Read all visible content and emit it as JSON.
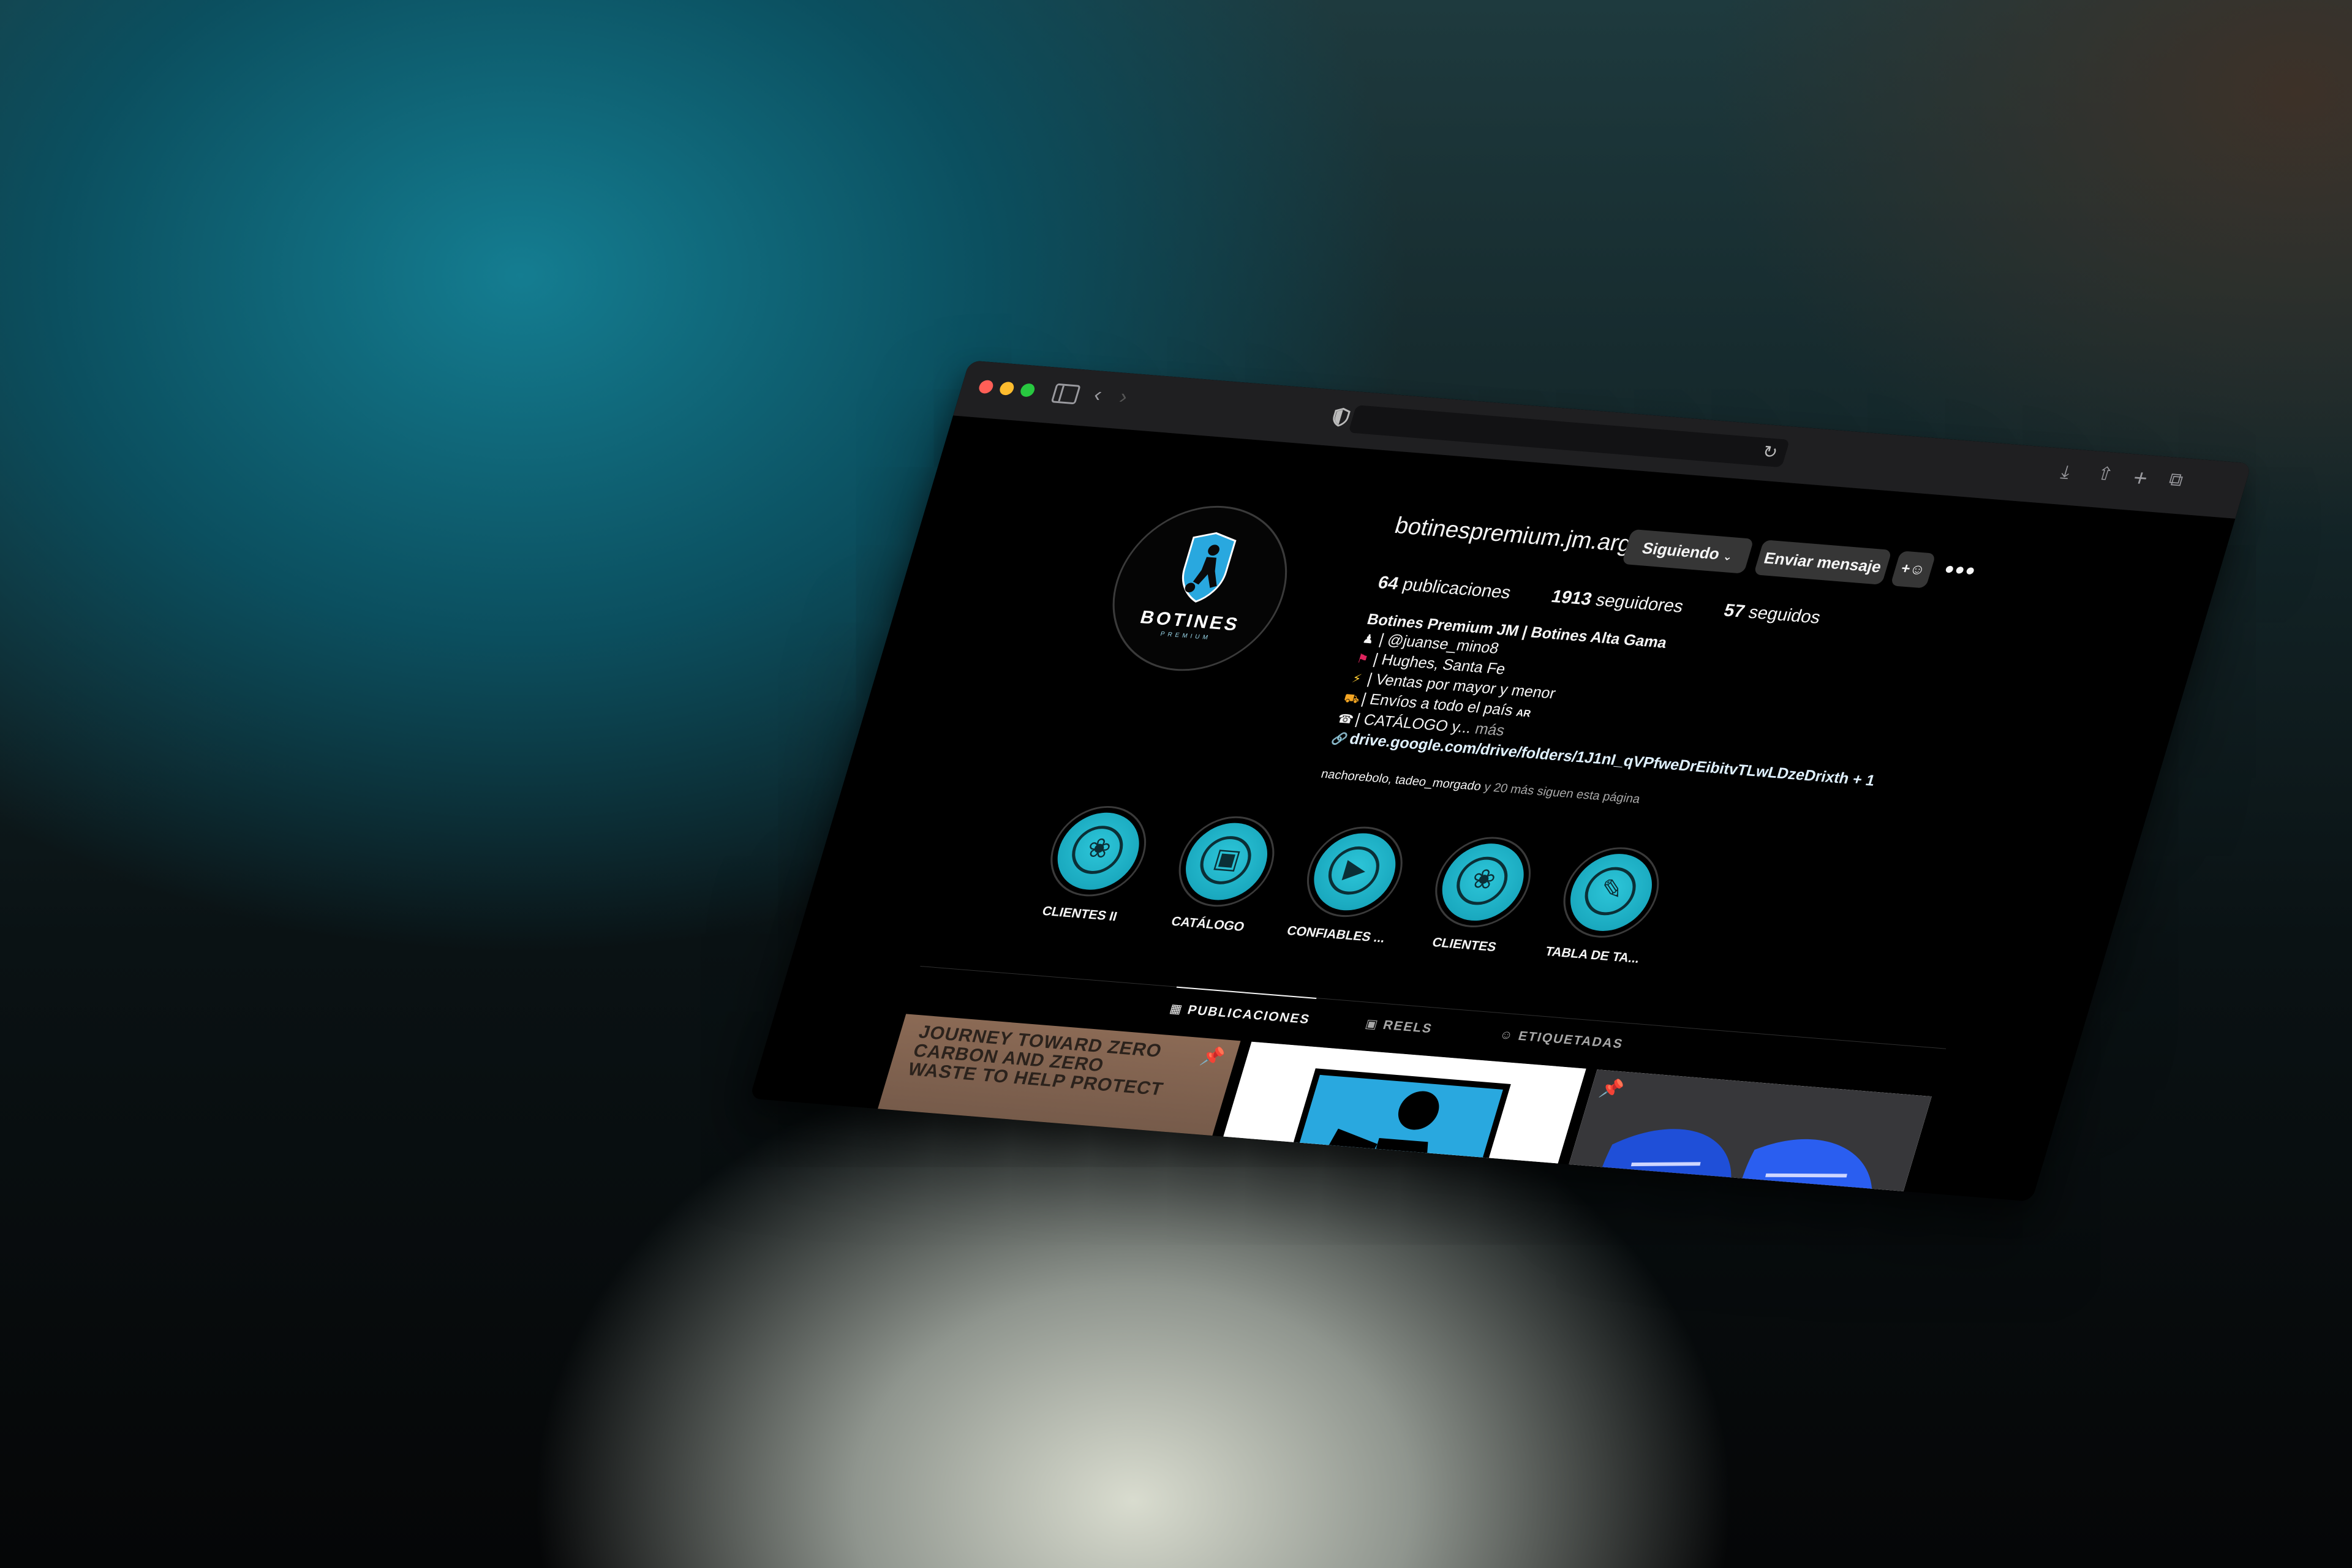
{
  "browser": {
    "tab_icon": "shield-icon",
    "reload_icon": "reload-icon",
    "toolbar_icons": [
      "download-icon",
      "share-icon",
      "new-tab-icon",
      "tabs-overview-icon"
    ]
  },
  "profile": {
    "username": "botinespremium.jm.arg",
    "avatar_logo_text": "BOTINES",
    "avatar_logo_sub": "PREMIUM",
    "following_button": "Siguiendo",
    "message_button": "Enviar mensaje",
    "suggest_button": "+",
    "more_button": "•••",
    "stats": {
      "posts_count": "64",
      "posts_label": "publicaciones",
      "followers_count": "1913",
      "followers_label": "seguidores",
      "following_count": "57",
      "following_label": "seguidos"
    },
    "bio": {
      "name": "Botines Premium JM | Botines Alta Gama",
      "line1": "| @juanse_mino8",
      "line2": "| Hughes, Santa Fe",
      "line3": "| Ventas por mayor y menor",
      "line4": "| Envíos a todo el país",
      "line4_flag": "AR",
      "line5": "| CATÁLOGO y...",
      "line5_more": "más",
      "link": "drive.google.com/drive/folders/1J1nI_qVPfweDrEibitvTLwLDzeDrixth",
      "link_extra": "+ 1"
    },
    "followed_by": {
      "users": "nachorebolo, tadeo_morgado",
      "rest": "y 20 más siguen esta página"
    }
  },
  "highlights": [
    {
      "label": "CLIENTES II",
      "icon": "handshake-icon"
    },
    {
      "label": "CATÁLOGO",
      "icon": "box-icon"
    },
    {
      "label": "CONFIABLES ...",
      "icon": "video-icon"
    },
    {
      "label": "CLIENTES",
      "icon": "handshake-icon"
    },
    {
      "label": "TABLA DE TA...",
      "icon": "ruler-icon"
    }
  ],
  "tabs": {
    "posts": "PUBLICACIONES",
    "reels": "REELS",
    "tagged": "ETIQUETADAS"
  },
  "posts": [
    {
      "caption_on_box": "JOURNEY TOWARD ZERO\nCARBON AND ZERO\nWASTE TO HELP PROTECT",
      "pinned": true
    },
    {
      "pinned": false
    },
    {
      "pinned": true
    }
  ],
  "colors": {
    "accent_teal": "#1aa9bf",
    "background": "#000000",
    "button": "#363636"
  }
}
